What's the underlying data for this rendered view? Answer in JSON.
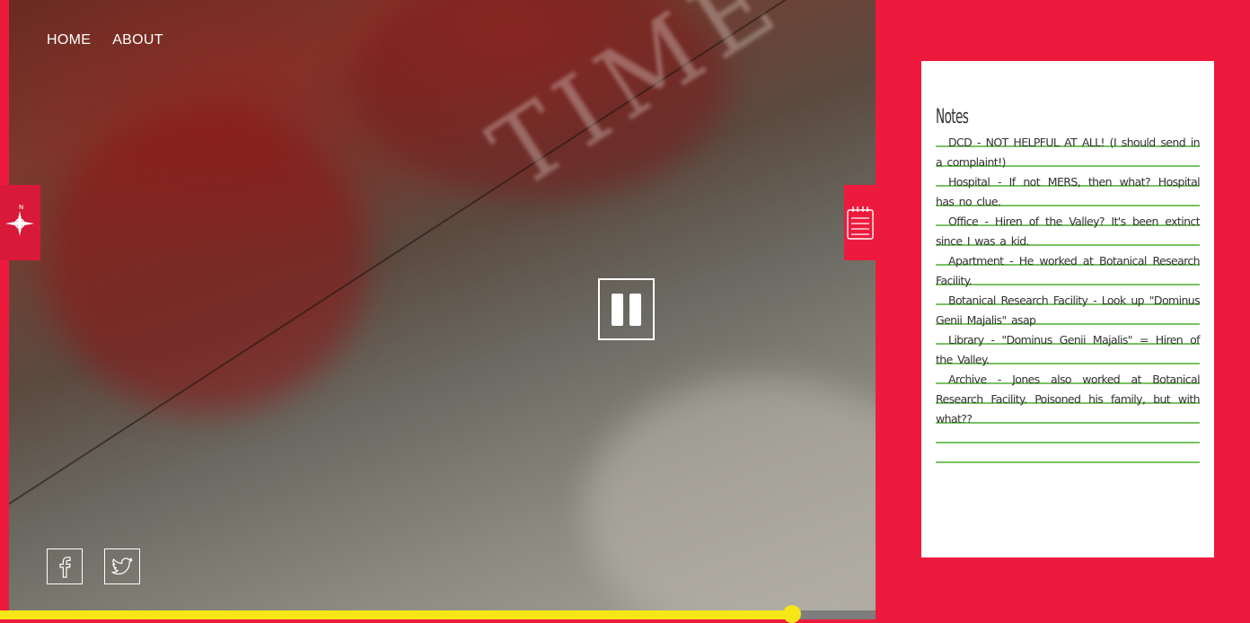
{
  "nav": {
    "items": [
      {
        "label": "HOME"
      },
      {
        "label": "ABOUT"
      }
    ]
  },
  "video": {
    "state": "paused",
    "background_text": "TIME",
    "progress": 0.905
  },
  "social": {
    "icons": [
      "facebook-icon",
      "twitter-icon"
    ]
  },
  "side_tabs": {
    "compass_letter": "N"
  },
  "notes": {
    "title": "Notes",
    "entries": [
      "DCD - NOT HELPFUL AT ALL! (I should send in a complaint!)",
      "Hospital - If not MERS, then what? Hospital has no clue.",
      "Office - Hiren of the Valley? It's been extinct since I was a kid.",
      "Apartment - He worked at Botanical Research Facility.",
      "Botanical Research Facility - Look up \"Dominus Genii Majalis\" asap",
      "Library - \"Dominus Genii Majalis\" = Hiren of the Valley.",
      "Archive - Jones also worked at Botanical Research Facility. Poisoned his family, but with what??"
    ]
  },
  "colors": {
    "brand_red": "#ee1a3d",
    "progress_yellow": "#f6e617",
    "notes_rule_green": "#78c264"
  }
}
